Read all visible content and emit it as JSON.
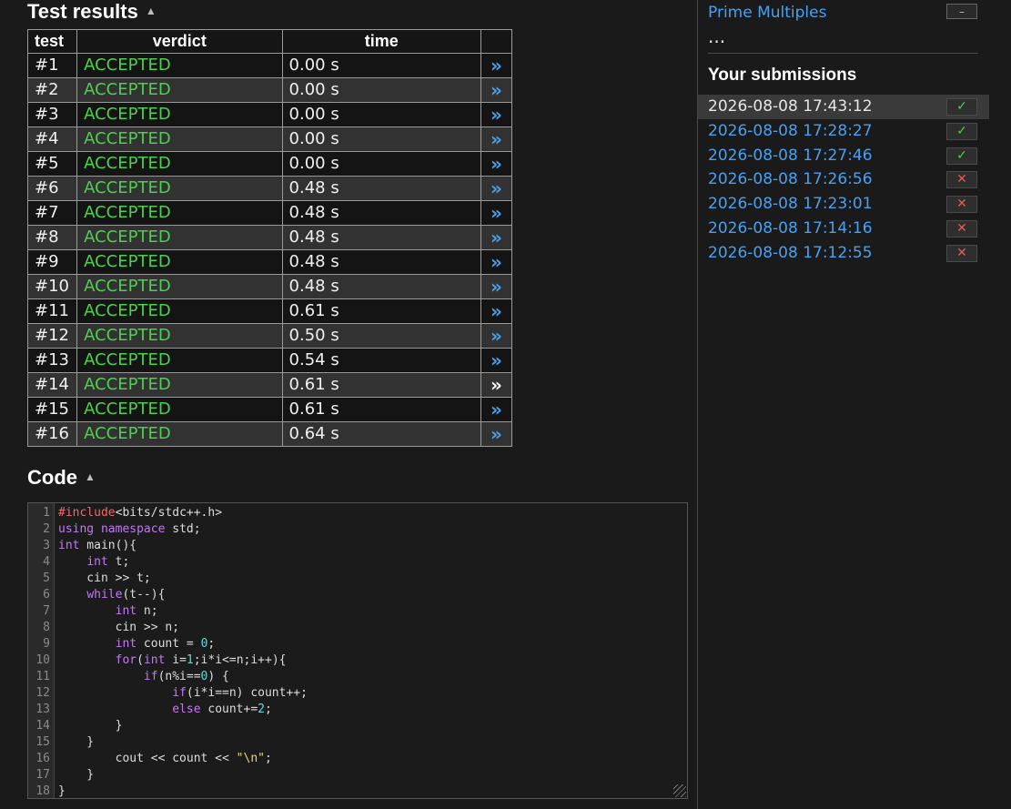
{
  "results": {
    "title": "Test results",
    "headers": [
      "test",
      "verdict",
      "time",
      ""
    ],
    "link_glyph": "»",
    "rows": [
      {
        "test": "#1",
        "verdict": "ACCEPTED",
        "time": "0.00 s"
      },
      {
        "test": "#2",
        "verdict": "ACCEPTED",
        "time": "0.00 s"
      },
      {
        "test": "#3",
        "verdict": "ACCEPTED",
        "time": "0.00 s"
      },
      {
        "test": "#4",
        "verdict": "ACCEPTED",
        "time": "0.00 s"
      },
      {
        "test": "#5",
        "verdict": "ACCEPTED",
        "time": "0.00 s"
      },
      {
        "test": "#6",
        "verdict": "ACCEPTED",
        "time": "0.48 s"
      },
      {
        "test": "#7",
        "verdict": "ACCEPTED",
        "time": "0.48 s"
      },
      {
        "test": "#8",
        "verdict": "ACCEPTED",
        "time": "0.48 s"
      },
      {
        "test": "#9",
        "verdict": "ACCEPTED",
        "time": "0.48 s"
      },
      {
        "test": "#10",
        "verdict": "ACCEPTED",
        "time": "0.48 s"
      },
      {
        "test": "#11",
        "verdict": "ACCEPTED",
        "time": "0.61 s"
      },
      {
        "test": "#12",
        "verdict": "ACCEPTED",
        "time": "0.50 s"
      },
      {
        "test": "#13",
        "verdict": "ACCEPTED",
        "time": "0.54 s"
      },
      {
        "test": "#14",
        "verdict": "ACCEPTED",
        "time": "0.61 s"
      },
      {
        "test": "#15",
        "verdict": "ACCEPTED",
        "time": "0.61 s"
      },
      {
        "test": "#16",
        "verdict": "ACCEPTED",
        "time": "0.64 s"
      }
    ]
  },
  "code": {
    "title": "Code",
    "lines": [
      [
        [
          "pre",
          "#include"
        ],
        [
          "plain",
          "<bits/stdc++.h>"
        ]
      ],
      [
        [
          "kw",
          "using"
        ],
        [
          "plain",
          " "
        ],
        [
          "kw",
          "namespace"
        ],
        [
          "plain",
          " std;"
        ]
      ],
      [
        [
          "kw",
          "int"
        ],
        [
          "plain",
          " main(){"
        ]
      ],
      [
        [
          "plain",
          "    "
        ],
        [
          "kw",
          "int"
        ],
        [
          "plain",
          " t;"
        ]
      ],
      [
        [
          "plain",
          "    cin >> t;"
        ]
      ],
      [
        [
          "plain",
          "    "
        ],
        [
          "kw",
          "while"
        ],
        [
          "plain",
          "(t--){"
        ]
      ],
      [
        [
          "plain",
          "        "
        ],
        [
          "kw",
          "int"
        ],
        [
          "plain",
          " n;"
        ]
      ],
      [
        [
          "plain",
          "        cin >> n;"
        ]
      ],
      [
        [
          "plain",
          "        "
        ],
        [
          "kw",
          "int"
        ],
        [
          "plain",
          " count = "
        ],
        [
          "num",
          "0"
        ],
        [
          "plain",
          ";"
        ]
      ],
      [
        [
          "plain",
          "        "
        ],
        [
          "kw",
          "for"
        ],
        [
          "plain",
          "("
        ],
        [
          "kw",
          "int"
        ],
        [
          "plain",
          " i="
        ],
        [
          "num",
          "1"
        ],
        [
          "plain",
          ";i*i<=n;i++){"
        ]
      ],
      [
        [
          "plain",
          "            "
        ],
        [
          "kw",
          "if"
        ],
        [
          "plain",
          "(n%i=="
        ],
        [
          "num",
          "0"
        ],
        [
          "plain",
          ") {"
        ]
      ],
      [
        [
          "plain",
          "                "
        ],
        [
          "kw",
          "if"
        ],
        [
          "plain",
          "(i*i==n) count++;"
        ]
      ],
      [
        [
          "plain",
          "                "
        ],
        [
          "kw",
          "else"
        ],
        [
          "plain",
          " count+="
        ],
        [
          "num",
          "2"
        ],
        [
          "plain",
          ";"
        ]
      ],
      [
        [
          "plain",
          "        }"
        ]
      ],
      [
        [
          "plain",
          "    }"
        ]
      ],
      [
        [
          "plain",
          "        cout << count << "
        ],
        [
          "str",
          "\"\\n\""
        ],
        [
          "plain",
          ";"
        ]
      ],
      [
        [
          "plain",
          "    }"
        ]
      ],
      [
        [
          "plain",
          "}"
        ]
      ]
    ]
  },
  "sidebar": {
    "task_link": "Prime Multiples",
    "collapse_label": "–",
    "ellipsis": "...",
    "submissions_title": "Your submissions",
    "submissions": [
      {
        "time": "2026-08-08 17:43:12",
        "status": "ok",
        "current": true
      },
      {
        "time": "2026-08-08 17:28:27",
        "status": "ok",
        "current": false
      },
      {
        "time": "2026-08-08 17:27:46",
        "status": "ok",
        "current": false
      },
      {
        "time": "2026-08-08 17:26:56",
        "status": "fail",
        "current": false
      },
      {
        "time": "2026-08-08 17:23:01",
        "status": "fail",
        "current": false
      },
      {
        "time": "2026-08-08 17:14:16",
        "status": "fail",
        "current": false
      },
      {
        "time": "2026-08-08 17:12:55",
        "status": "fail",
        "current": false
      }
    ],
    "status_glyphs": {
      "ok": "✓",
      "fail": "✕"
    }
  },
  "colors": {
    "accepted": "#4cd14c",
    "link": "#4aa0f0",
    "fail": "#e85a5a"
  }
}
